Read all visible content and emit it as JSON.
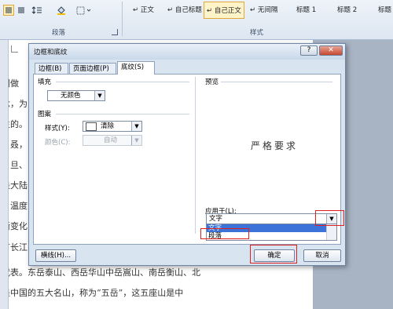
{
  "ribbon": {
    "styles": [
      "↵ 正文",
      "↵ 自己标题",
      "↵ 自己正文",
      "↵ 无间隔",
      "标题 1",
      "标题 2",
      "标题"
    ],
    "paragraph_group_label": "段落",
    "styles_group_label": "样式"
  },
  "document": {
    "lines": [
      "叫做",
      "念，为",
      "生的。",
      "、叒，",
      "、旦、",
      "是大陆",
      "，温度",
      "渐变化",
      "有长江",
      "代表。东岳泰山、西岳华山中岳嵩山、南岳衡山、北",
      "是中国的五大名山，称为“五岳”，这五座山是中"
    ]
  },
  "dialog": {
    "title": "边框和底纹",
    "help_label": "?",
    "close_label": "✕",
    "tabs": [
      "边框(B)",
      "页面边框(P)",
      "底纹(S)"
    ],
    "fill": {
      "section_label": "填充",
      "value": "无颜色"
    },
    "pattern": {
      "section_label": "图案",
      "style_label": "样式(Y):",
      "style_value": "清除",
      "color_label": "颜色(C):",
      "color_value": "自动"
    },
    "preview": {
      "section_label": "预览",
      "sample_text": "严格要求"
    },
    "apply_to": {
      "label": "应用于(L):",
      "value": "文字",
      "options": [
        "文字",
        "段落"
      ]
    },
    "buttons": {
      "horizontal_line": "横线(H)...",
      "ok": "确定",
      "cancel": "取消"
    }
  },
  "colors": {
    "highlight": "#3b73d9",
    "annotation": "#e02020"
  }
}
